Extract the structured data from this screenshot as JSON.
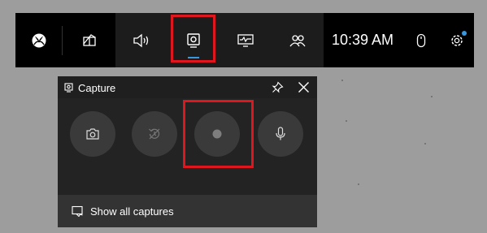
{
  "top_bar": {
    "time": "10:39 AM",
    "icons": [
      "xbox-icon",
      "widget-menu-icon",
      "audio-icon",
      "capture-icon",
      "performance-icon",
      "social-icon",
      "mouse-icon",
      "settings-icon"
    ],
    "active_widget": "capture",
    "accent_color": "#3a96dd"
  },
  "capture_panel": {
    "title": "Capture",
    "buttons": [
      "screenshot-icon",
      "record-last-30s-icon",
      "start-recording-icon",
      "microphone-icon"
    ],
    "footer_label": "Show all captures"
  },
  "highlight_color": "#e0161e"
}
